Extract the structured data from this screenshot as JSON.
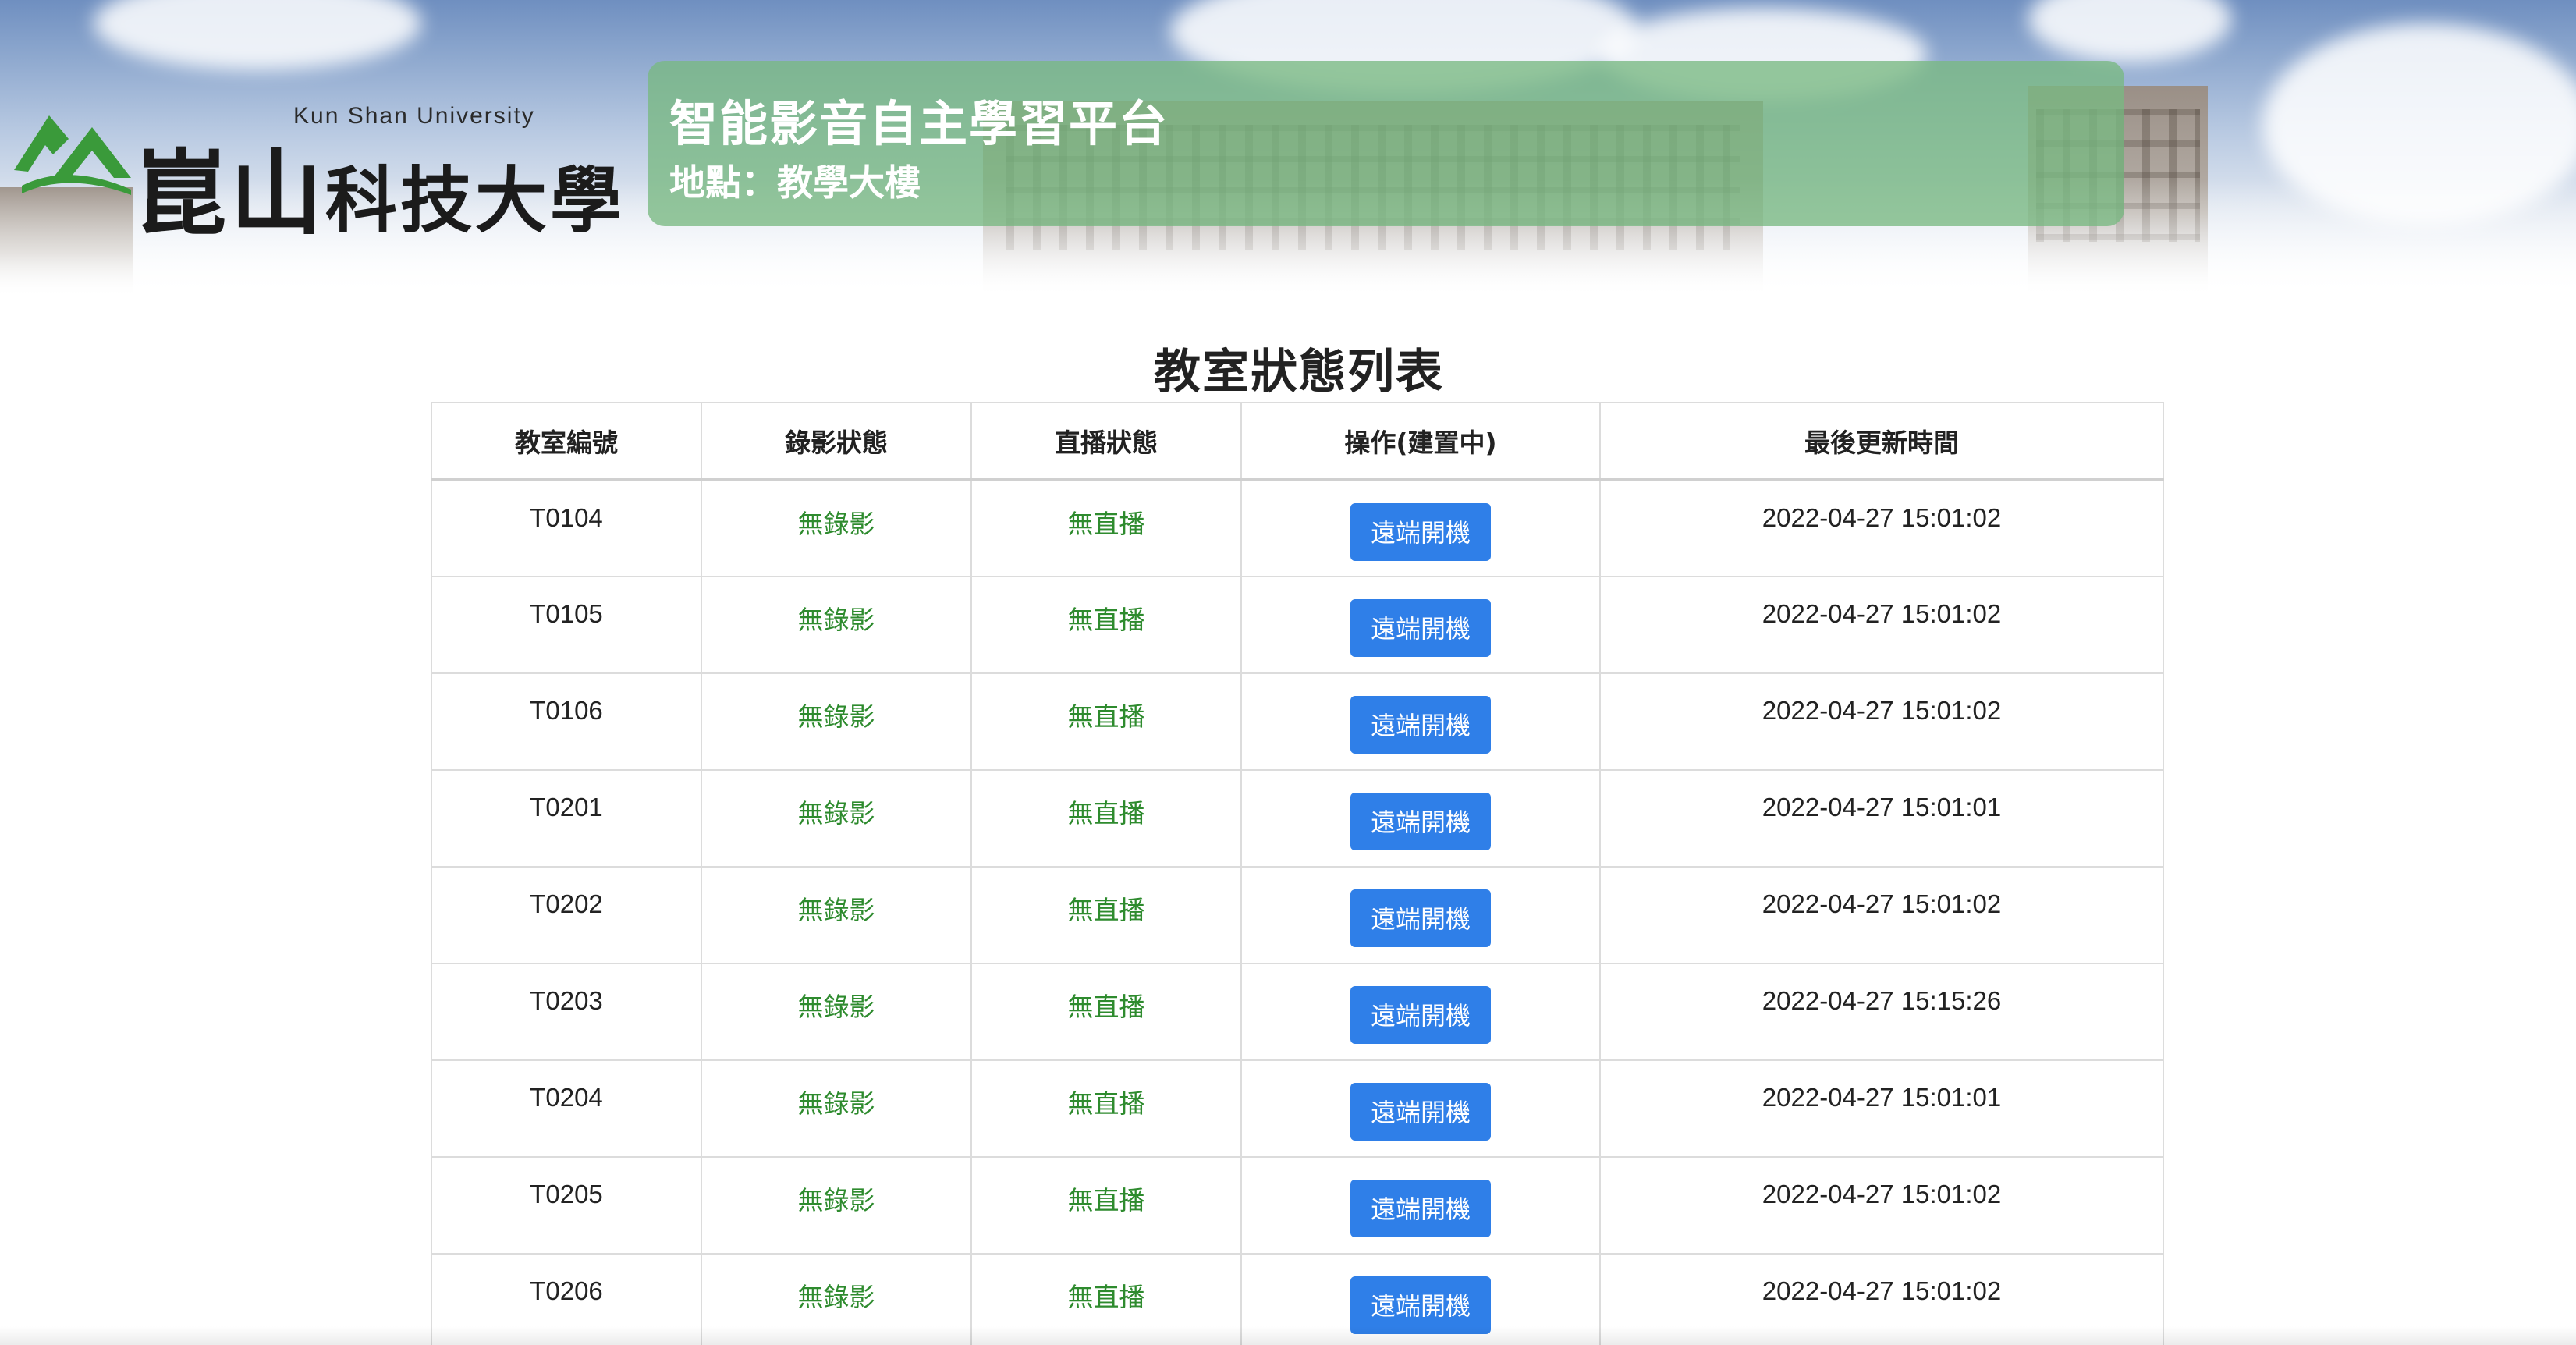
{
  "header": {
    "logo_en": "Kun Shan University",
    "logo_cn_1": "崑山",
    "logo_cn_2": "科技大學",
    "platform_title": "智能影音自主學習平台",
    "location": "地點：教學大樓"
  },
  "main": {
    "heading": "教室狀態列表",
    "columns": [
      "教室編號",
      "錄影狀態",
      "直播狀態",
      "操作(建置中)",
      "最後更新時間"
    ],
    "rows": [
      {
        "room": "T0104",
        "recording": "無錄影",
        "streaming": "無直播",
        "action": "遠端開機",
        "updated": "2022-04-27 15:01:02"
      },
      {
        "room": "T0105",
        "recording": "無錄影",
        "streaming": "無直播",
        "action": "遠端開機",
        "updated": "2022-04-27 15:01:02"
      },
      {
        "room": "T0106",
        "recording": "無錄影",
        "streaming": "無直播",
        "action": "遠端開機",
        "updated": "2022-04-27 15:01:02"
      },
      {
        "room": "T0201",
        "recording": "無錄影",
        "streaming": "無直播",
        "action": "遠端開機",
        "updated": "2022-04-27 15:01:01"
      },
      {
        "room": "T0202",
        "recording": "無錄影",
        "streaming": "無直播",
        "action": "遠端開機",
        "updated": "2022-04-27 15:01:02"
      },
      {
        "room": "T0203",
        "recording": "無錄影",
        "streaming": "無直播",
        "action": "遠端開機",
        "updated": "2022-04-27 15:15:26"
      },
      {
        "room": "T0204",
        "recording": "無錄影",
        "streaming": "無直播",
        "action": "遠端開機",
        "updated": "2022-04-27 15:01:01"
      },
      {
        "room": "T0205",
        "recording": "無錄影",
        "streaming": "無直播",
        "action": "遠端開機",
        "updated": "2022-04-27 15:01:02"
      },
      {
        "room": "T0206",
        "recording": "無錄影",
        "streaming": "無直播",
        "action": "遠端開機",
        "updated": "2022-04-27 15:01:02"
      }
    ]
  },
  "colors": {
    "status_green": "#2e8b2e",
    "button_blue": "#2f7fe8",
    "title_card_green": "#78b982",
    "logo_green": "#3a9a3a"
  },
  "icons": {
    "logo_mark": "kun-shan-logo-icon"
  }
}
